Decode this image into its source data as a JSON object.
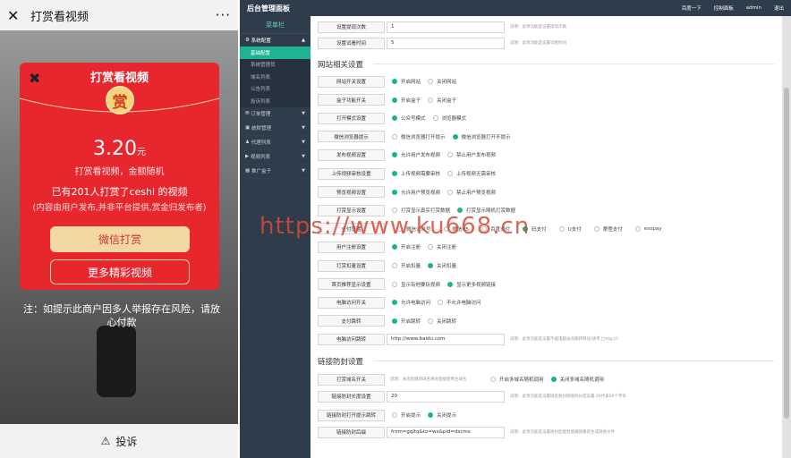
{
  "phone": {
    "title": "打赏看视频",
    "modal_title": "打赏看视频",
    "coin": "赏",
    "amount": "3.20",
    "unit": "元",
    "line1": "打赏看视频，金额随机",
    "line2": "已有201人打赏了ceshi 的视频",
    "line3": "(内容由用户发布,并非平台提供,赏金归发布者)",
    "pay_button": "微信打赏",
    "more_button": "更多精彩视频",
    "note": "注：如提示此商户因多人举报存在风险，请放心付款",
    "report": "投诉"
  },
  "admin": {
    "brand": "后台管理面板",
    "top_links": [
      "百度一下",
      "控制面板",
      "admin",
      "退出"
    ],
    "sidebar": {
      "header": "菜单栏",
      "group": "系统配置",
      "subs": [
        "基础配置",
        "系统管理员",
        "域名列表",
        "公告列表",
        "投诉列表"
      ],
      "menus": [
        "订单管理",
        "统财管理",
        "代理列表",
        "视频列表",
        "推广盒子"
      ]
    },
    "top_rows": [
      {
        "label": "设置提现次数",
        "value": "1",
        "hint": "说明：此项功能是设置提现次数"
      },
      {
        "label": "设置试看时间",
        "value": "5",
        "hint": "说明：此项功能是设置试看时间"
      }
    ],
    "section1": "网站相关设置",
    "radio_rows": [
      {
        "label": "网站开关设置",
        "options": [
          "开启网站",
          "关闭网站"
        ],
        "on": 0
      },
      {
        "label": "盒子功能开关",
        "options": [
          "开启盒子",
          "关闭盒子"
        ],
        "on": 0
      },
      {
        "label": "打开模式设置",
        "options": [
          "公众号模式",
          "浏览器模式"
        ],
        "on": 0
      },
      {
        "label": "微信浏览器提示",
        "options": [
          "微信浏览器打开提示",
          "微信浏览器打开不提示"
        ],
        "on": 1
      },
      {
        "label": "发布视频设置",
        "options": [
          "允许用户发布视频",
          "禁止用户发布视频"
        ],
        "on": 0
      },
      {
        "label": "上传视频审核设置",
        "options": [
          "上传视频需要审核",
          "上传视频无需审核"
        ],
        "on": 0
      },
      {
        "label": "预览视频设置",
        "options": [
          "允许用户预览视频",
          "禁止用户预览视频"
        ],
        "on": 0
      },
      {
        "label": "打赏显示设置",
        "options": [
          "打赏显示真实打赏数据",
          "打赏显示随机打赏数据"
        ],
        "on": 1
      },
      {
        "label": "支付设置",
        "options": [
          "微信公众号",
          "微信H5",
          "百度支付",
          "码支付",
          "U支付",
          "摩登支付",
          "esopay"
        ],
        "on": 3
      },
      {
        "label": "用户注册设置",
        "options": [
          "开启注册",
          "关闭注册"
        ],
        "on": 0
      },
      {
        "label": "打赏扣量设置",
        "options": [
          "开启扣量",
          "关闭扣量"
        ],
        "on": 1
      },
      {
        "label": "首页推荐显示设置",
        "options": [
          "显示有他要玩视频",
          "显示更多视频链接"
        ],
        "on": 1
      },
      {
        "label": "电脑访问开关",
        "options": [
          "允许电脑访问",
          "不允许电脑访问"
        ],
        "on": 0
      },
      {
        "label": "支付跳转",
        "options": [
          "开启跳转",
          "关闭跳转"
        ],
        "on": 0
      }
    ],
    "pc_row": {
      "label": "电脑访问跳转",
      "value": "http://www.baidu.com",
      "hint": "说明：此项功能是设置不能电脑访问跳转网址(请带上http://)"
    },
    "section2": "链接防封设置",
    "anti_rows": [
      {
        "label": "打赏域名开关",
        "hint": "说明：关闭后跳转域名将会直接使用主域名",
        "options": [
          "开启多域名随机调用",
          "关闭多域名随机调用"
        ],
        "on": 1
      },
      {
        "label": "链接防封长度设置",
        "value": "20",
        "hint": "说明：此项功能是设置域名防封链接的长度设置 20代表20个字符"
      },
      {
        "label": "链接防封打开提示跳转",
        "options": [
          "开启提示",
          "关闭提示"
        ],
        "on": 1
      },
      {
        "label": "链接防封后缀",
        "value": "from=gqltq&to=wx&pid=dscms",
        "hint": "说明：此项功能是设置防封后缀智能跟随重新生成链接文件"
      }
    ]
  },
  "watermark": "https://www.ku668.cn"
}
